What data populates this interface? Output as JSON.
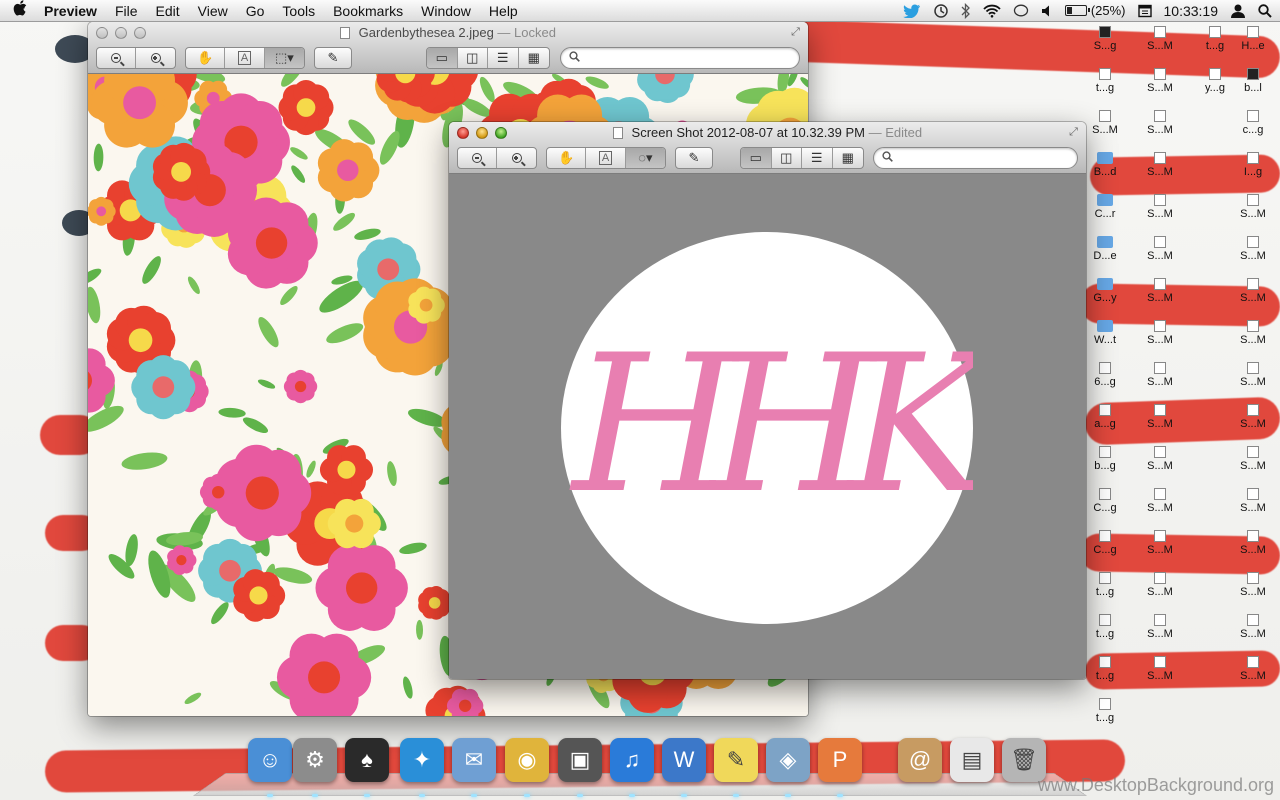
{
  "menubar": {
    "app_name": "Preview",
    "menus": [
      "File",
      "Edit",
      "View",
      "Go",
      "Tools",
      "Bookmarks",
      "Window",
      "Help"
    ],
    "battery_text": "(25%)",
    "battery_level": 0.25,
    "clock": "10:33:19"
  },
  "window_back": {
    "title": "Gardenbythesea 2.jpeg",
    "status": "— Locked",
    "search_placeholder": ""
  },
  "window_front": {
    "title": "Screen Shot 2012-08-07 at 10.32.39 PM",
    "status": "— Edited",
    "search_placeholder": "",
    "monogram": "HHK",
    "monogram_color": "#e87fb1",
    "canvas_color": "#898989"
  },
  "desktop_icons": [
    {
      "label": "S...g",
      "kind": "dark"
    },
    {
      "label": "S...M",
      "kind": "file"
    },
    {
      "label": "t...g",
      "kind": "file"
    },
    {
      "label": "H...e",
      "kind": "file"
    },
    {
      "label": "t...g",
      "kind": "file"
    },
    {
      "label": "S...M",
      "kind": "file"
    },
    {
      "label": "y...g",
      "kind": "file"
    },
    {
      "label": "b...l",
      "kind": "dark"
    },
    {
      "label": "S...M",
      "kind": "file"
    },
    {
      "label": "S...M",
      "kind": "file"
    },
    {
      "label": "c...g",
      "kind": "file"
    },
    {
      "label": "B...d",
      "kind": "folder"
    },
    {
      "label": "S...M",
      "kind": "file"
    },
    {
      "label": "I...g",
      "kind": "file"
    },
    {
      "label": "C...r",
      "kind": "folder"
    },
    {
      "label": "S...M",
      "kind": "file"
    },
    {
      "label": "S...M",
      "kind": "file"
    },
    {
      "label": "D...e",
      "kind": "folder"
    },
    {
      "label": "S...M",
      "kind": "file"
    },
    {
      "label": "S...M",
      "kind": "file"
    },
    {
      "label": "G...y",
      "kind": "folder"
    },
    {
      "label": "S...M",
      "kind": "file"
    },
    {
      "label": "S...M",
      "kind": "file"
    },
    {
      "label": "W...t",
      "kind": "folder"
    },
    {
      "label": "S...M",
      "kind": "file"
    },
    {
      "label": "S...M",
      "kind": "file"
    },
    {
      "label": "6...g",
      "kind": "file"
    },
    {
      "label": "S...M",
      "kind": "file"
    },
    {
      "label": "S...M",
      "kind": "file"
    },
    {
      "label": "a...g",
      "kind": "file"
    },
    {
      "label": "S...M",
      "kind": "file"
    },
    {
      "label": "S...M",
      "kind": "file"
    },
    {
      "label": "b...g",
      "kind": "file"
    },
    {
      "label": "S...M",
      "kind": "file"
    },
    {
      "label": "S...M",
      "kind": "file"
    },
    {
      "label": "C...g",
      "kind": "file"
    },
    {
      "label": "S...M",
      "kind": "file"
    },
    {
      "label": "S...M",
      "kind": "file"
    },
    {
      "label": "C...g",
      "kind": "file"
    },
    {
      "label": "S...M",
      "kind": "file"
    },
    {
      "label": "S...M",
      "kind": "file"
    },
    {
      "label": "t...g",
      "kind": "file"
    },
    {
      "label": "S...M",
      "kind": "file"
    },
    {
      "label": "S...M",
      "kind": "file"
    },
    {
      "label": "t...g",
      "kind": "file"
    },
    {
      "label": "S...M",
      "kind": "file"
    },
    {
      "label": "S...M",
      "kind": "file"
    },
    {
      "label": "t...g",
      "kind": "file"
    },
    {
      "label": "S...M",
      "kind": "file"
    },
    {
      "label": "S...M",
      "kind": "file"
    },
    {
      "label": "t...g",
      "kind": "file"
    }
  ],
  "dock": {
    "apps": [
      {
        "name": "finder",
        "color": "#4a8fd6",
        "glyph": "☺"
      },
      {
        "name": "system-preferences",
        "color": "#8c8c8c",
        "glyph": "⚙"
      },
      {
        "name": "skull-app",
        "color": "#2a2a2a",
        "glyph": "♠"
      },
      {
        "name": "twitter",
        "color": "#2a8fd8",
        "glyph": "✦"
      },
      {
        "name": "mail",
        "color": "#6f9fd3",
        "glyph": "✉"
      },
      {
        "name": "chrome",
        "color": "#e0b43b",
        "glyph": "◉"
      },
      {
        "name": "iphoto",
        "color": "#555555",
        "glyph": "▣"
      },
      {
        "name": "itunes",
        "color": "#2a7bd9",
        "glyph": "♫"
      },
      {
        "name": "word",
        "color": "#3c78c9",
        "glyph": "W"
      },
      {
        "name": "stickies",
        "color": "#f0d85a",
        "glyph": "✎"
      },
      {
        "name": "preview",
        "color": "#7da3c6",
        "glyph": "◈"
      },
      {
        "name": "powerpoint",
        "color": "#e67a3c",
        "glyph": "P"
      },
      {
        "name": "address-book",
        "color": "#c79b62",
        "glyph": "@"
      },
      {
        "name": "document",
        "color": "#e8e8e8",
        "glyph": "▤"
      },
      {
        "name": "trash",
        "color": "#b5b5b5",
        "glyph": "🗑"
      }
    ]
  },
  "watermark": "www.DesktopBackground.org"
}
